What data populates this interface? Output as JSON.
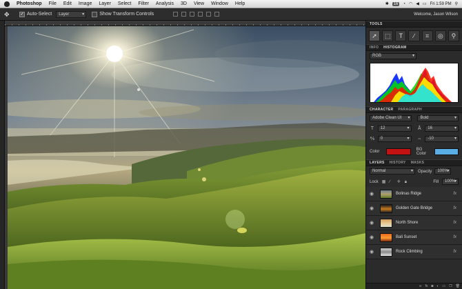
{
  "menubar": {
    "app": "Photoshop",
    "menus": [
      "File",
      "Edit",
      "Image",
      "Layer",
      "Select",
      "Filter",
      "Analysis",
      "3D",
      "View",
      "Window",
      "Help"
    ],
    "status": {
      "badge": "16",
      "clock": "Fri 1:59 PM"
    }
  },
  "options": {
    "auto_select_label": "Auto-Select",
    "auto_select_checked": true,
    "target": "Layer",
    "show_transform_label": "Show Transform Controls",
    "show_transform_checked": false,
    "welcome": "Welcome, Jason Wilson"
  },
  "panels": {
    "tools_title": "TOOLS",
    "tools": [
      "move-tool",
      "marquee-tool",
      "type-tool",
      "brush-tool",
      "crop-tool",
      "lasso-tool",
      "zoom-tool"
    ],
    "info_tab": "INFO",
    "histogram_tab": "HISTOGRAM",
    "histogram_channel": "RGB",
    "character_tab": "CHARACTER",
    "paragraph_tab": "PARAGRAPH",
    "font_family": "Adobe Clean UI",
    "font_style": "Bold",
    "font_size": "12",
    "leading": "16",
    "kerning": "0",
    "tracking": "-10",
    "color_label": "Color",
    "text_color": "#c41212",
    "bg_color_label": "BG Color",
    "bg_color": "#5aaee6",
    "layers_tab": "LAYERS",
    "history_tab": "HISTORY",
    "masks_tab": "MASKS",
    "blend_mode": "Normal",
    "opacity_label": "Opacity",
    "opacity_value": "100%",
    "lock_label": "Lock",
    "fill_label": "Fill",
    "fill_value": "100%",
    "layers": [
      {
        "name": "Bolinas Ridge",
        "fx": "fx"
      },
      {
        "name": "Golden Gate Bridge",
        "fx": "fx"
      },
      {
        "name": "North Shore",
        "fx": "fx"
      },
      {
        "name": "Bali Sunset",
        "fx": "fx"
      },
      {
        "name": "Rock Climbing",
        "fx": "fx"
      }
    ]
  }
}
